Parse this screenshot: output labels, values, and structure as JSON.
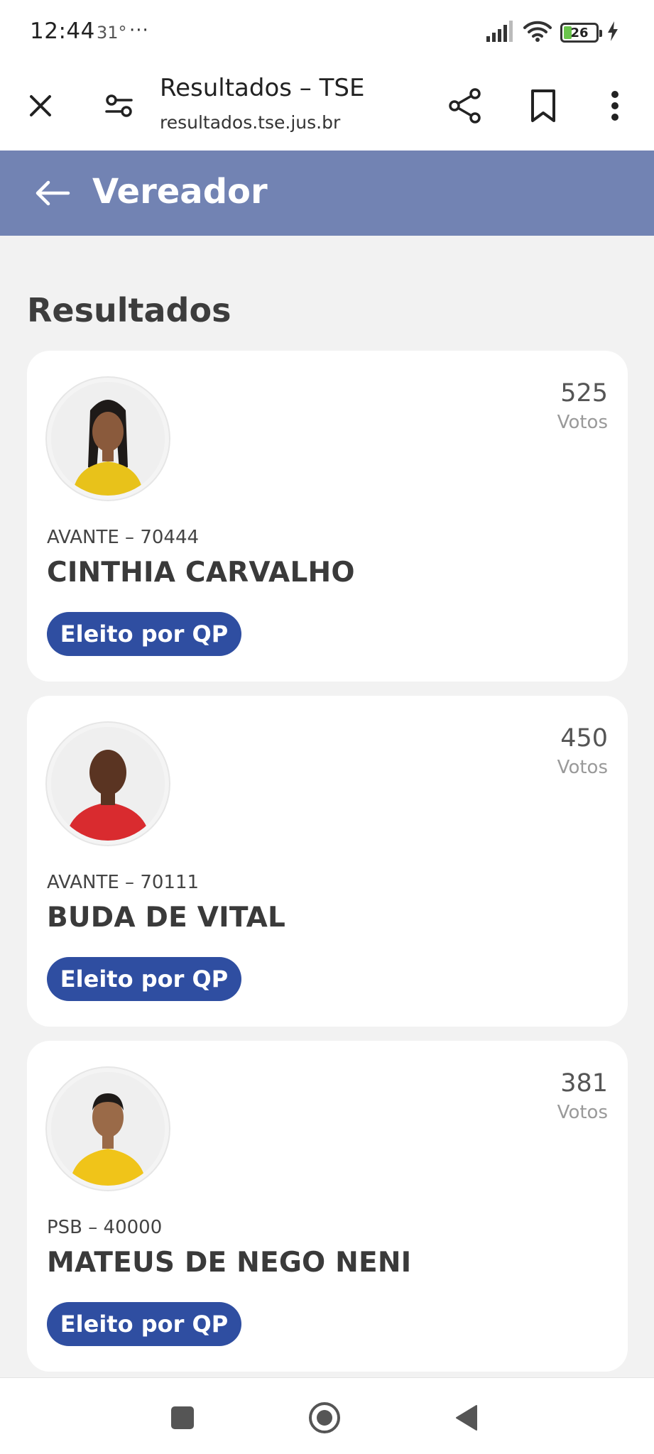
{
  "status_bar": {
    "time": "12:44",
    "temperature": "31°",
    "more": "···",
    "battery": "26",
    "battery_level": 0.26
  },
  "browser": {
    "title": "Resultados – TSE",
    "url": "resultados.tse.jus.br",
    "icons": [
      "close-icon",
      "tune-icon",
      "share-icon",
      "bookmark-icon",
      "more-vert-icon"
    ]
  },
  "header": {
    "title": "Vereador"
  },
  "main": {
    "section_title": "Resultados",
    "candidates": [
      {
        "party": "AVANTE – 70444",
        "name": "CINTHIA CARVALHO",
        "votes": "525",
        "votes_label": "Votos",
        "status": "Eleito por QP",
        "shirt_color": "#e8c21a",
        "skin_color": "#8a5a3c",
        "hair": "long"
      },
      {
        "party": "AVANTE – 70111",
        "name": "BUDA DE VITAL",
        "votes": "450",
        "votes_label": "Votos",
        "status": "Eleito por QP",
        "shirt_color": "#d92b2f",
        "skin_color": "#5a3422",
        "hair": "bald"
      },
      {
        "party": "PSB – 40000",
        "name": "MATEUS DE NEGO NENI",
        "votes": "381",
        "votes_label": "Votos",
        "status": "Eleito por QP",
        "shirt_color": "#f0c419",
        "skin_color": "#9a6a48",
        "hair": "short"
      }
    ]
  },
  "colors": {
    "header_bg": "#7283b3",
    "badge_bg": "#2f4ea1",
    "page_bg": "#f2f2f2"
  }
}
